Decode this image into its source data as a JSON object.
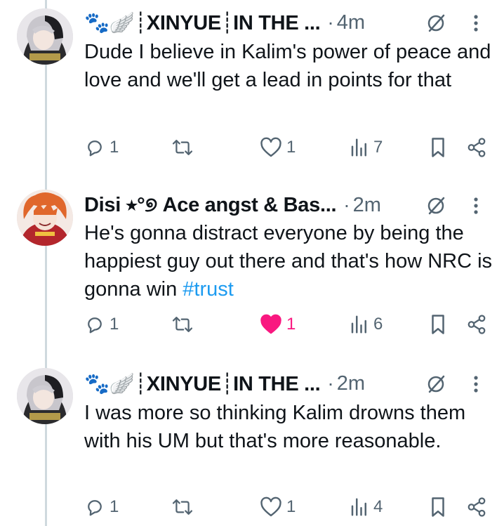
{
  "tweets": [
    {
      "author": "🐾🪽┊XINYUE┊IN THE ...",
      "separator": "·",
      "time": "4m",
      "text": "Dude I believe in Kalim's power of peace and love and we'll get a lead in points for that",
      "hashtag": "",
      "replies": "1",
      "likes": "1",
      "liked": false,
      "views": "7"
    },
    {
      "author": "Disi ⭑°୭ Ace angst & Bas...",
      "separator": "·",
      "time": "2m",
      "text": "He's gonna distract everyone by being the happiest guy out there and that's how NRC is gonna win",
      "hashtag": "#trust",
      "replies": "1",
      "likes": "1",
      "liked": true,
      "views": "6"
    },
    {
      "author": "🐾🪽┊XINYUE┊IN THE ...",
      "separator": "·",
      "time": "2m",
      "text": "I was more so thinking Kalim drowns them with his UM but that's more reasonable.",
      "hashtag": "",
      "replies": "1",
      "likes": "1",
      "liked": false,
      "views": "4"
    }
  ],
  "icons": {
    "grok": "slashed-circle-icon",
    "more": "more-vertical-icon",
    "reply": "reply-icon",
    "retweet": "retweet-icon",
    "like": "heart-icon",
    "views": "views-icon",
    "bookmark": "bookmark-icon",
    "share": "share-icon"
  },
  "colors": {
    "text": "#0f1419",
    "muted": "#536471",
    "link": "#1d9bf0",
    "like": "#f91880",
    "thread_line": "#cfd9de"
  }
}
